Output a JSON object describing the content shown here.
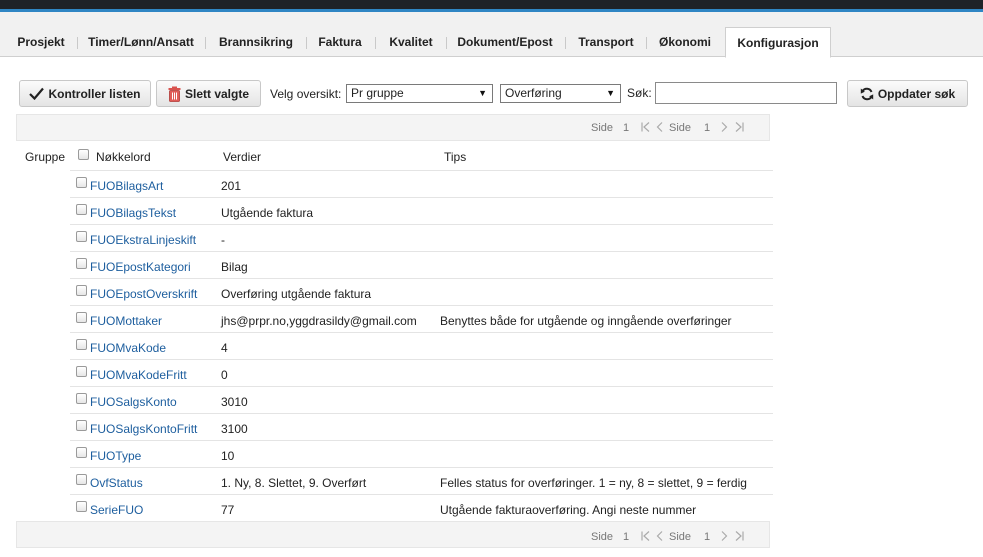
{
  "tabs": [
    {
      "label": "Prosjekt"
    },
    {
      "label": "Timer/Lønn/Ansatt"
    },
    {
      "label": "Brannsikring"
    },
    {
      "label": "Faktura"
    },
    {
      "label": "Kvalitet"
    },
    {
      "label": "Dokument/Epost"
    },
    {
      "label": "Transport"
    },
    {
      "label": "Økonomi"
    },
    {
      "label": "Konfigurasjon",
      "active": true
    }
  ],
  "toolbar": {
    "check_label": "Kontroller listen",
    "delete_label": "Slett valgte",
    "view_label": "Velg oversikt:",
    "view_select": "Pr gruppe",
    "type_select": "Overføring",
    "search_label": "Søk:",
    "search_value": "",
    "refresh_label": "Oppdater søk"
  },
  "pager": {
    "side_label": "Side",
    "current": "1",
    "side_label2": "Side",
    "total": "1"
  },
  "table": {
    "headers": {
      "group": "Gruppe",
      "key": "Nøkkelord",
      "values": "Verdier",
      "tips": "Tips"
    },
    "rows": [
      {
        "key": "FUOBilagsArt",
        "value": "201",
        "tip": ""
      },
      {
        "key": "FUOBilagsTekst",
        "value": "Utgående faktura",
        "tip": ""
      },
      {
        "key": "FUOEkstraLinjeskift",
        "value": "-",
        "tip": ""
      },
      {
        "key": "FUOEpostKategori",
        "value": "Bilag",
        "tip": ""
      },
      {
        "key": "FUOEpostOverskrift",
        "value": "Overføring utgående faktura",
        "tip": ""
      },
      {
        "key": "FUOMottaker",
        "value": "jhs@prpr.no,yggdrasildy@gmail.com",
        "tip": "Benyttes både for utgående og inngående overføringer"
      },
      {
        "key": "FUOMvaKode",
        "value": "4",
        "tip": ""
      },
      {
        "key": "FUOMvaKodeFritt",
        "value": "0",
        "tip": ""
      },
      {
        "key": "FUOSalgsKonto",
        "value": "3010",
        "tip": ""
      },
      {
        "key": "FUOSalgsKontoFritt",
        "value": "3100",
        "tip": ""
      },
      {
        "key": "FUOType",
        "value": "10",
        "tip": ""
      },
      {
        "key": "OvfStatus",
        "value": "1. Ny, 8. Slettet, 9. Overført",
        "tip": "Felles status for overføringer. 1 = ny, 8 = slettet, 9 = ferdig"
      },
      {
        "key": "SerieFUO",
        "value": "77",
        "tip": "Utgående fakturaoverføring. Angi neste nummer"
      }
    ]
  },
  "colors": {
    "link": "#1d5e9e",
    "topbar": "#1e2228",
    "accent": "#2f86c4"
  }
}
